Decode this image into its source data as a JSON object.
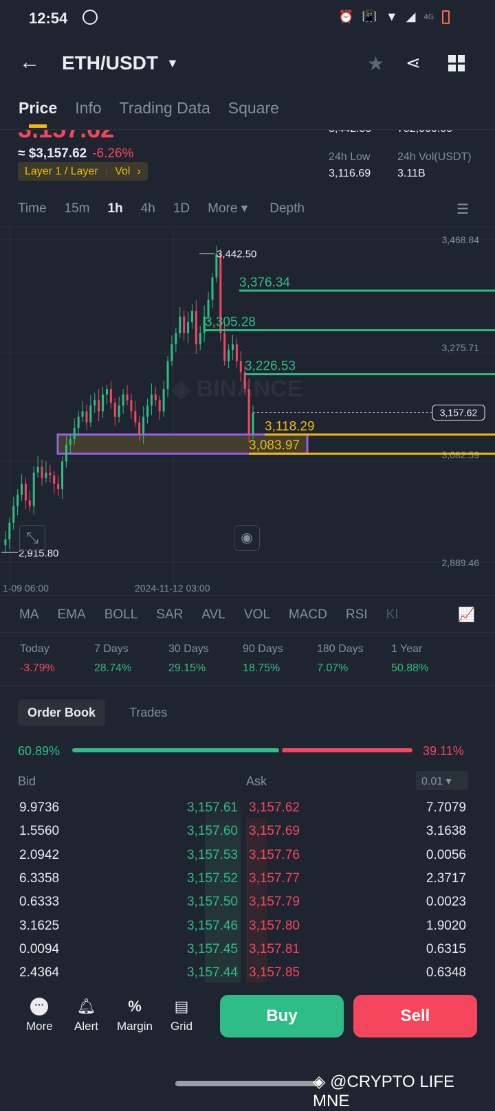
{
  "status": {
    "time": "12:54",
    "network": "4G"
  },
  "header": {
    "pair": "ETH/USDT"
  },
  "tabs": [
    "Price",
    "Info",
    "Trading Data",
    "Square"
  ],
  "ticker": {
    "price_partial": "3,157.62",
    "usd_price": "≈ $3,157.62",
    "change": "-6.26%",
    "tag": "Layer 1 / Layer",
    "tag2": "Vol",
    "high_partial": "3,442.50",
    "vol_partial": "782,000.00",
    "low_label": "24h Low",
    "low": "3,116.69",
    "volusdt_label": "24h Vol(USDT)",
    "volusdt": "3.11B"
  },
  "timeframes": [
    "Time",
    "15m",
    "1h",
    "4h",
    "1D",
    "More",
    "Depth"
  ],
  "chart_data": {
    "type": "candlestick",
    "ylim": [
      2889.46,
      3468.84
    ],
    "y_ticks": [
      "3,468.84",
      "3,275.71",
      "3,082.59",
      "2,889.46"
    ],
    "x_ticks": [
      "1-09 06:00",
      "2024-11-12 03:00"
    ],
    "high_label": "3,442.50",
    "low_label": "2,915.80",
    "last_price": "3,157.62",
    "levels": [
      {
        "value": 3376.34,
        "label": "3,376.34",
        "color": "#2ebd85"
      },
      {
        "value": 3305.28,
        "label": "3,305.28",
        "color": "#2ebd85"
      },
      {
        "value": 3226.53,
        "label": "3,226.53",
        "color": "#2ebd85"
      },
      {
        "value": 3118.29,
        "label": "3,118.29",
        "color": "#f0b90b"
      },
      {
        "value": 3083.97,
        "label": "3,083.97",
        "color": "#f0b90b"
      }
    ],
    "zone": [
      3083.97,
      3118.29
    ],
    "closes": [
      2920,
      2930,
      2960,
      2990,
      3010,
      3030,
      3000,
      2990,
      3050,
      3060,
      3040,
      3050,
      3045,
      3030,
      3020,
      3070,
      3100,
      3110,
      3130,
      3150,
      3160,
      3140,
      3170,
      3180,
      3160,
      3190,
      3200,
      3175,
      3150,
      3170,
      3190,
      3180,
      3160,
      3140,
      3120,
      3150,
      3170,
      3190,
      3180,
      3160,
      3200,
      3250,
      3280,
      3300,
      3330,
      3300,
      3320,
      3340,
      3280,
      3300,
      3330,
      3360,
      3400,
      3442,
      3300,
      3250,
      3270,
      3280,
      3250,
      3230,
      3200,
      3120,
      3157
    ]
  },
  "indicators": [
    "MA",
    "EMA",
    "BOLL",
    "SAR",
    "AVL",
    "VOL",
    "MACD",
    "RSI",
    "KI"
  ],
  "performance": [
    {
      "label": "Today",
      "value": "-3.79%",
      "neg": true
    },
    {
      "label": "7 Days",
      "value": "28.74%"
    },
    {
      "label": "30 Days",
      "value": "29.15%"
    },
    {
      "label": "90 Days",
      "value": "18.75%"
    },
    {
      "label": "180 Days",
      "value": "7.07%"
    },
    {
      "label": "1 Year",
      "value": "50.88%"
    }
  ],
  "orderbook": {
    "tab1": "Order Book",
    "tab2": "Trades",
    "bid_pct": "60.89%",
    "ask_pct": "39.11%",
    "bid_ratio": 0.6089,
    "bid_label": "Bid",
    "ask_label": "Ask",
    "precision": "0.01",
    "rows": [
      [
        "9.9736",
        "3,157.61",
        "3,157.62",
        "7.7079"
      ],
      [
        "1.5560",
        "3,157.60",
        "3,157.69",
        "3.1638"
      ],
      [
        "2.0942",
        "3,157.53",
        "3,157.76",
        "0.0056"
      ],
      [
        "6.3358",
        "3,157.52",
        "3,157.77",
        "2.3717"
      ],
      [
        "0.6333",
        "3,157.50",
        "3,157.79",
        "0.0023"
      ],
      [
        "3.1625",
        "3,157.46",
        "3,157.80",
        "1.9020"
      ],
      [
        "0.0094",
        "3,157.45",
        "3,157.81",
        "0.6315"
      ],
      [
        "2.4364",
        "3,157.44",
        "3,157.85",
        "0.6348"
      ]
    ]
  },
  "bottom": {
    "more": "More",
    "alert": "Alert",
    "margin": "Margin",
    "grid": "Grid",
    "buy": "Buy",
    "sell": "Sell"
  },
  "watermark": "@CRYPTO LIFE MNE"
}
